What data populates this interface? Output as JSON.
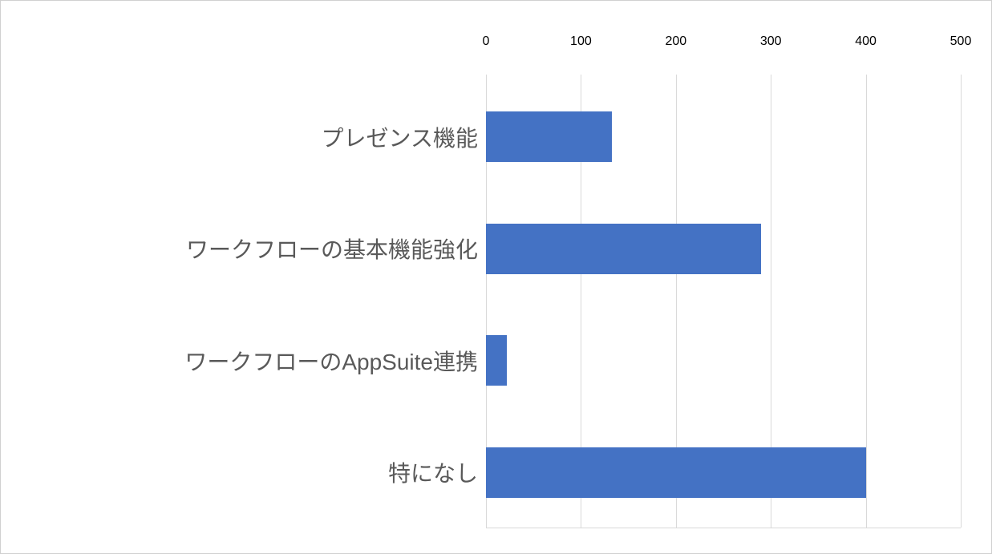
{
  "chart_data": {
    "type": "bar",
    "orientation": "horizontal",
    "categories": [
      "プレゼンス機能",
      "ワークフローの基本機能強化",
      "ワークフローのAppSuite連携",
      "特になし"
    ],
    "values": [
      133,
      290,
      22,
      400
    ],
    "xlim": [
      0,
      500
    ],
    "xticks": [
      0,
      100,
      200,
      300,
      400,
      500
    ],
    "bar_color": "#4472c4",
    "title": "",
    "xlabel": "",
    "ylabel": ""
  }
}
